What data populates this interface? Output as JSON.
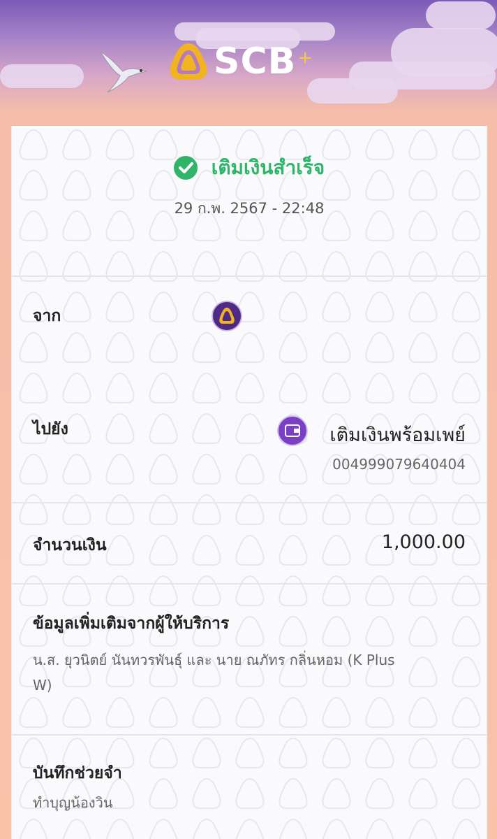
{
  "brand": {
    "name": "SCB",
    "plus": "+"
  },
  "receipt": {
    "status": "เติมเงินสำเร็จ",
    "datetime": "29 ก.พ. 2567 - 22:48",
    "from_label": "จาก",
    "to_label": "ไปยัง",
    "to_name": "เติมเงินพร้อมเพย์",
    "to_account": "004999079640404",
    "amount_label": "จำนวนเงิน",
    "amount": "1,000.00",
    "extra_title": "ข้อมูลเพิ่มเติมจากผู้ให้บริการ",
    "extra_line1": "น.ส. ยุวนิตย์ นันทวรพันธุ์ และ นาย ณภัทร กลิ่นหอม (K Plus",
    "extra_line2": "W)",
    "memo_label": "บันทึกช่วยจำ",
    "memo": "ทำบุญน้องวิน"
  },
  "colors": {
    "success": "#2fb56a",
    "brand_purple": "#4e2a84",
    "brand_gold": "#f2b322"
  },
  "icons": [
    "scb-logo-icon",
    "bird-icon",
    "check-circle-icon",
    "scb-mini-logo-icon",
    "wallet-icon"
  ]
}
